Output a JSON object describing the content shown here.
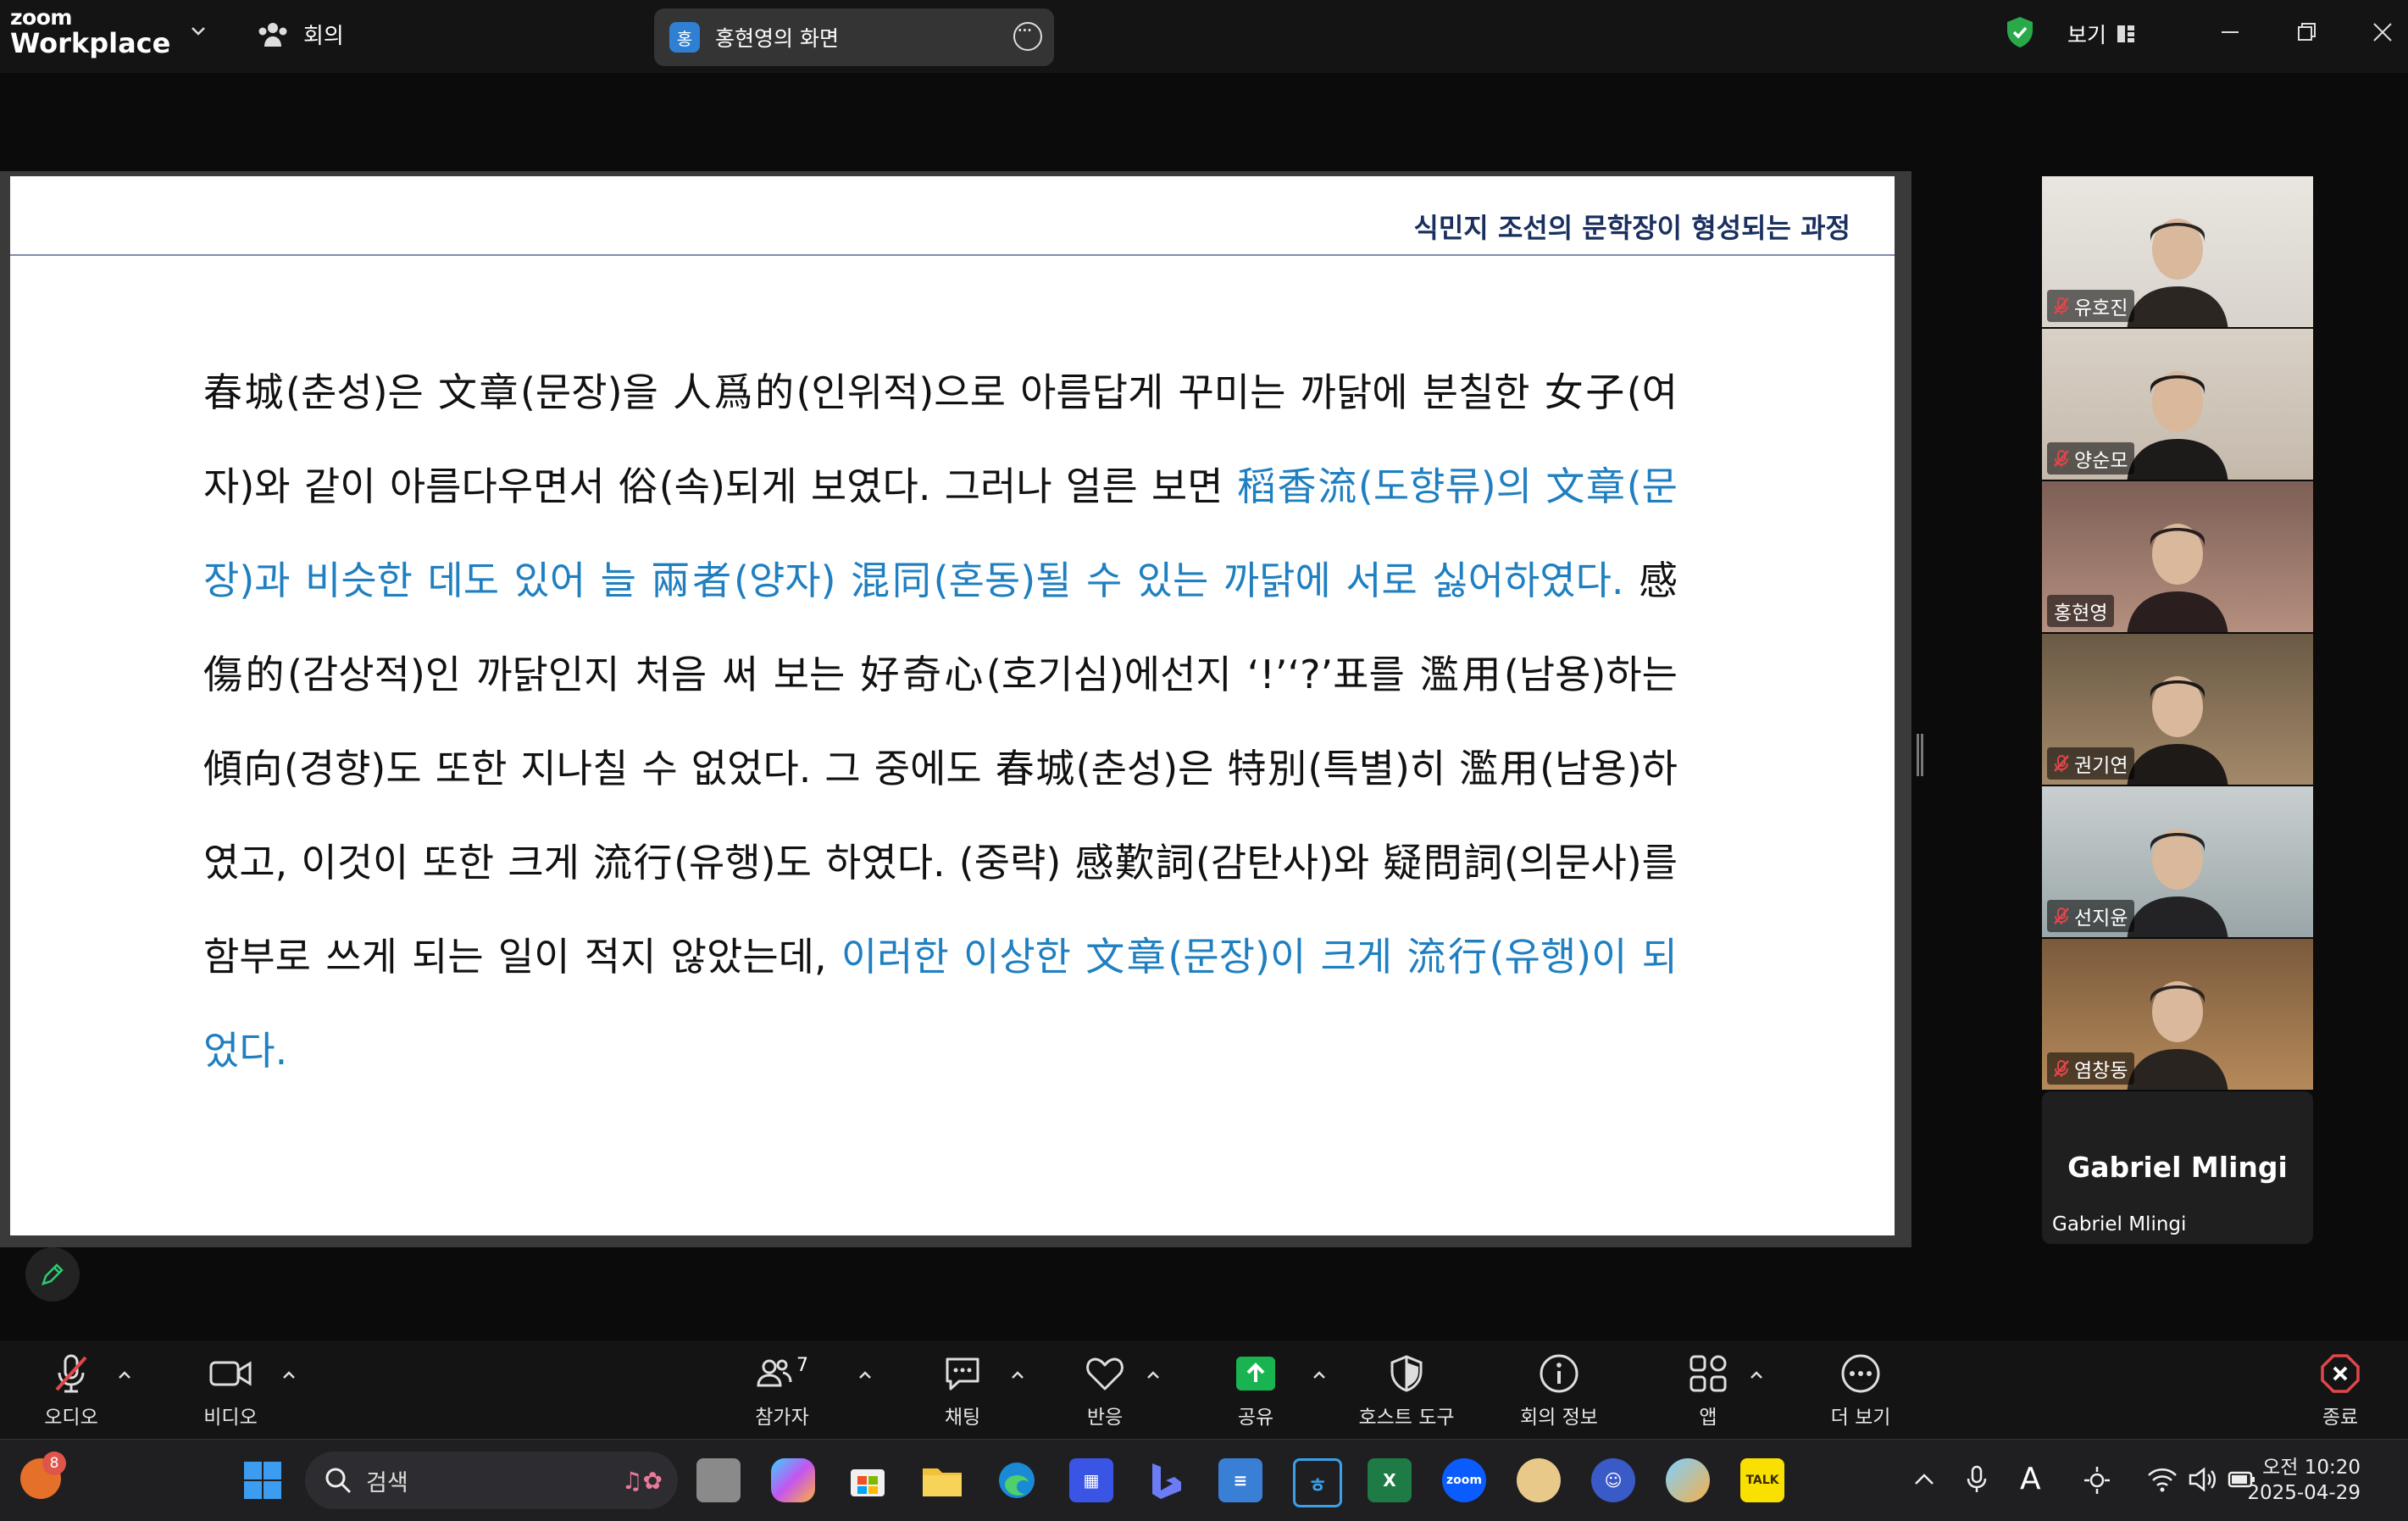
{
  "app": {
    "brand_small": "zoom",
    "brand_large": "Workplace"
  },
  "topbar": {
    "meeting_label": "회의",
    "share_badge": "홍",
    "share_title": "홍현영의 화면",
    "view_label": "보기"
  },
  "slide": {
    "title": "식민지 조선의 문학장이 형성되는 과정",
    "segments": [
      {
        "text": "春城(춘성)은 文章(문장)을 人爲的(인위적)으로 아름답게 꾸미는 까닭에 분칠한 女子(여자)와 같이 아름다우면서 俗(속)되게 보였다. 그러나 얼른 보면 ",
        "highlight": false
      },
      {
        "text": "稻香流(도향류)의 文章(문장)과 비슷한 데도 있어 늘 兩者(양자) 混同(혼동)될 수 있는 까닭에 서로 싫어하였다.",
        "highlight": true
      },
      {
        "text": " 感傷的(감상적)인 까닭인지 처음 써 보는 好奇心(호기심)에선지 ‘!’‘?’표를 濫用(남용)하는 傾向(경향)도 또한 지나칠 수 없었다. 그 중에도 春城(춘성)은 特別(특별)히 濫用(남용)하였고, 이것이 또한 크게 流行(유행)도 하였다. (중략) 感歎詞(감탄사)와 疑問詞(의문사)를 함부로 쓰게 되는 일이 적지 않았는데, ",
        "highlight": false
      },
      {
        "text": "이러한 이상한 文章(문장)이 크게 流行(유행)이 되었다.",
        "highlight": true
      }
    ]
  },
  "participants": [
    {
      "name": "유호진",
      "muted": true,
      "active": false
    },
    {
      "name": "양순모",
      "muted": true,
      "active": false
    },
    {
      "name": "홍현영",
      "muted": false,
      "active": true
    },
    {
      "name": "권기연",
      "muted": true,
      "active": false
    },
    {
      "name": "선지윤",
      "muted": true,
      "active": false
    },
    {
      "name": "염창동",
      "muted": true,
      "active": false
    }
  ],
  "no_video_participant": {
    "display": "Gabriel Mlingi",
    "label": "Gabriel Mlingi"
  },
  "toolbar": {
    "audio": "오디오",
    "video": "비디오",
    "participants": "참가자",
    "participants_count": "7",
    "chat": "채팅",
    "reactions": "반응",
    "share": "공유",
    "host_tools": "호스트 도구",
    "meeting_info": "회의 정보",
    "apps": "앱",
    "more": "더 보기",
    "end": "종료"
  },
  "taskbar": {
    "notification_count": "8",
    "search_placeholder": "검색",
    "time": "오전 10:20",
    "date": "2025-04-29",
    "ime_label": "A",
    "kakao_label": "TALK",
    "zoom_label": "zoom"
  },
  "colors": {
    "accent_green": "#2ecc71",
    "share_green": "#19b451",
    "end_red": "#e0464a",
    "slide_highlight": "#1f7fc0"
  }
}
